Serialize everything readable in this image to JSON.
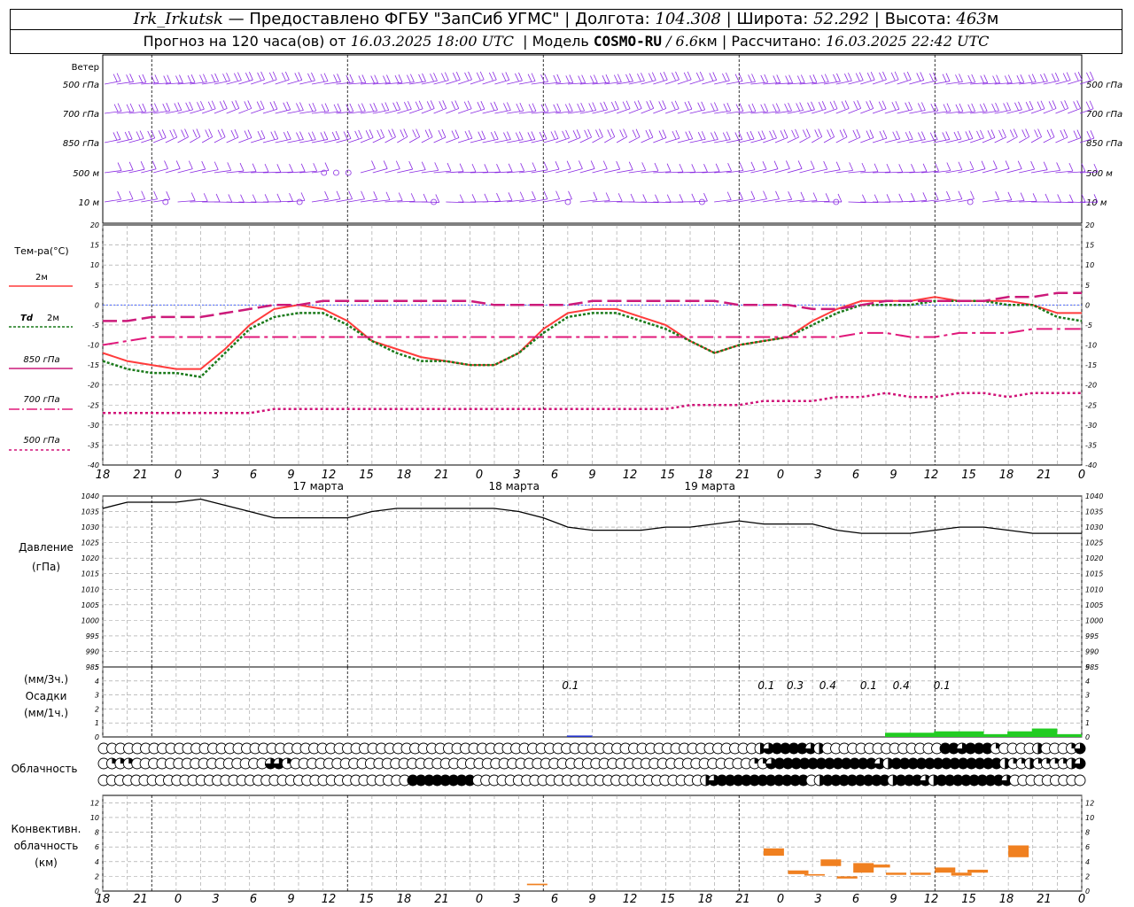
{
  "header": {
    "station": "Irk_Irkutsk",
    "dash": "—",
    "provider": "Предоставлено ФГБУ \"ЗапСиб УГМС\"",
    "lon_label": "Долгота:",
    "lon_value": "104.308",
    "lat_label": "Широта:",
    "lat_value": "52.292",
    "alt_label": "Высота:",
    "alt_value": "463",
    "alt_unit": "м",
    "forecast_label": "Прогноз на 120 часа(ов) от",
    "forecast_from": "16.03.2025 18:00 UTC",
    "model_label": "Модель",
    "model_name": "COSMO-RU",
    "model_res": "6.6",
    "model_res_unit": "км",
    "calc_label": "Рассчитано:",
    "calc_time": "16.03.2025 22:42 UTC"
  },
  "wind_panel": {
    "title": "Ветер",
    "levels": [
      "500 гПа",
      "700 гПа",
      "850 гПа",
      "500 м",
      "10 м"
    ],
    "color": "#8a2be2"
  },
  "time_axis": {
    "hour_ticks": [
      "18",
      "21",
      "0",
      "3",
      "6",
      "9",
      "12",
      "15",
      "18",
      "21",
      "0",
      "3",
      "6",
      "9",
      "12",
      "15",
      "18",
      "21",
      "0",
      "3",
      "6",
      "9",
      "12",
      "15",
      "18",
      "21",
      "0"
    ],
    "dates": [
      "17 марта",
      "18 марта",
      "19 марта"
    ]
  },
  "legend": {
    "temp_title": "Тем-ра(°С)",
    "t2m": "2м",
    "td_prefix": "Td",
    "td2m": "2м",
    "t850": "850 гПа",
    "t700": "700 гПа",
    "t500": "500 гПа"
  },
  "pressure_panel": {
    "title1": "Давление",
    "title2": "(гПа)"
  },
  "precip_panel": {
    "unit3": "(мм/3ч.)",
    "title": "Осадки",
    "unit1": "(мм/1ч.)",
    "labels": [
      "0.1",
      "0.1",
      "0.3",
      "0.4",
      "0.1",
      "0.4",
      "0.1"
    ]
  },
  "cloud_panel": {
    "title": "Облачность"
  },
  "conv_panel": {
    "title1": "Конвективн.",
    "title2": "облачность",
    "title3": "(км)"
  },
  "colors": {
    "t2m": "#ff3b3b",
    "td2m": "#1a7a1a",
    "t850": "#cc1a7a",
    "t700": "#e0187a",
    "t500": "#d01478",
    "pressure": "#000000",
    "precip_rain": "#22cc22",
    "precip_blue": "#2233cc",
    "conv": "#f08020",
    "wind": "#8a2be2",
    "zero_line": "#3050ff"
  },
  "chart_data": [
    {
      "type": "line",
      "name": "temperature",
      "x_hours": [
        0,
        3,
        6,
        9,
        12,
        15,
        18,
        21,
        24,
        27,
        30,
        33,
        36,
        39,
        42,
        45,
        48,
        51,
        54,
        57,
        60,
        63,
        66,
        69,
        72,
        75,
        78,
        81,
        84,
        87,
        90,
        93,
        96,
        99,
        102,
        105,
        108,
        111,
        114,
        117,
        120
      ],
      "ylim": [
        -40,
        20
      ],
      "series": [
        {
          "name": "2м",
          "values": [
            -12,
            -14,
            -15,
            -16,
            -16,
            -11,
            -5,
            -1,
            0,
            -1,
            -4,
            -9,
            -11,
            -13,
            -14,
            -15,
            -15,
            -12,
            -6,
            -2,
            -1,
            -1,
            -3,
            -5,
            -9,
            -12,
            -10,
            -9,
            -8,
            -4,
            -1,
            1,
            1,
            1,
            2,
            1,
            1,
            1,
            0,
            -2,
            -2
          ]
        },
        {
          "name": "Td 2м",
          "values": [
            -14,
            -16,
            -17,
            -17,
            -18,
            -12,
            -6,
            -3,
            -2,
            -2,
            -5,
            -9,
            -12,
            -14,
            -14,
            -15,
            -15,
            -12,
            -7,
            -3,
            -2,
            -2,
            -4,
            -6,
            -9,
            -12,
            -10,
            -9,
            -8,
            -5,
            -2,
            0,
            0,
            0,
            1,
            1,
            1,
            0,
            0,
            -3,
            -4
          ]
        },
        {
          "name": "850 гПа",
          "values": [
            -4,
            -4,
            -3,
            -3,
            -3,
            -2,
            -1,
            0,
            0,
            1,
            1,
            1,
            1,
            1,
            1,
            1,
            0,
            0,
            0,
            0,
            1,
            1,
            1,
            1,
            1,
            1,
            0,
            0,
            0,
            -1,
            -1,
            0,
            1,
            1,
            1,
            1,
            1,
            2,
            2,
            3,
            3
          ]
        },
        {
          "name": "700 гПа",
          "values": [
            -10,
            -9,
            -8,
            -8,
            -8,
            -8,
            -8,
            -8,
            -8,
            -8,
            -8,
            -8,
            -8,
            -8,
            -8,
            -8,
            -8,
            -8,
            -8,
            -8,
            -8,
            -8,
            -8,
            -8,
            -8,
            -8,
            -8,
            -8,
            -8,
            -8,
            -8,
            -7,
            -7,
            -8,
            -8,
            -7,
            -7,
            -7,
            -6,
            -6,
            -6
          ]
        },
        {
          "name": "500 гПа",
          "values": [
            -27,
            -27,
            -27,
            -27,
            -27,
            -27,
            -27,
            -26,
            -26,
            -26,
            -26,
            -26,
            -26,
            -26,
            -26,
            -26,
            -26,
            -26,
            -26,
            -26,
            -26,
            -26,
            -26,
            -26,
            -25,
            -25,
            -25,
            -24,
            -24,
            -24,
            -23,
            -23,
            -22,
            -23,
            -23,
            -22,
            -22,
            -23,
            -22,
            -22,
            -22
          ]
        }
      ]
    },
    {
      "type": "line",
      "name": "pressure",
      "x_hours": [
        0,
        3,
        6,
        9,
        12,
        15,
        18,
        21,
        24,
        27,
        30,
        33,
        36,
        39,
        42,
        45,
        48,
        51,
        54,
        57,
        60,
        63,
        66,
        69,
        72,
        75,
        78,
        81,
        84,
        87,
        90,
        93,
        96,
        99,
        102,
        105,
        108,
        111,
        114,
        117,
        120
      ],
      "ylim": [
        985,
        1040
      ],
      "values": [
        1036,
        1038,
        1038,
        1038,
        1039,
        1037,
        1035,
        1033,
        1033,
        1033,
        1033,
        1035,
        1036,
        1036,
        1036,
        1036,
        1036,
        1035,
        1033,
        1030,
        1029,
        1029,
        1029,
        1030,
        1030,
        1031,
        1032,
        1031,
        1031,
        1031,
        1029,
        1028,
        1028,
        1028,
        1029,
        1030,
        1030,
        1029,
        1028,
        1028,
        1028
      ]
    },
    {
      "type": "bar",
      "name": "precipitation",
      "x_hours": [
        57,
        96,
        99,
        102,
        105,
        108,
        111,
        114,
        117
      ],
      "values": [
        0.1,
        0.3,
        0.3,
        0.4,
        0.4,
        0.2,
        0.4,
        0.6,
        0.2
      ],
      "ylim": [
        0,
        5
      ]
    },
    {
      "type": "bar",
      "name": "convective_cloud",
      "ylim": [
        0,
        12
      ],
      "segments": [
        {
          "x_hours": 52,
          "base_km": 0.8,
          "top_km": 1.0
        },
        {
          "x_hours": 81,
          "base_km": 4.8,
          "top_km": 5.8
        },
        {
          "x_hours": 84,
          "base_km": 2.3,
          "top_km": 2.8
        },
        {
          "x_hours": 86,
          "base_km": 2.1,
          "top_km": 2.3
        },
        {
          "x_hours": 88,
          "base_km": 3.4,
          "top_km": 4.3
        },
        {
          "x_hours": 90,
          "base_km": 1.7,
          "top_km": 2.0
        },
        {
          "x_hours": 92,
          "base_km": 2.5,
          "top_km": 3.8
        },
        {
          "x_hours": 94,
          "base_km": 3.2,
          "top_km": 3.6
        },
        {
          "x_hours": 96,
          "base_km": 2.2,
          "top_km": 2.5
        },
        {
          "x_hours": 99,
          "base_km": 2.2,
          "top_km": 2.5
        },
        {
          "x_hours": 102,
          "base_km": 2.5,
          "top_km": 3.2
        },
        {
          "x_hours": 104,
          "base_km": 2.1,
          "top_km": 2.5
        },
        {
          "x_hours": 106,
          "base_km": 2.5,
          "top_km": 2.9
        },
        {
          "x_hours": 111,
          "base_km": 4.6,
          "top_km": 6.2
        }
      ]
    },
    {
      "type": "table",
      "name": "cloud_cover",
      "note_rows": [
        "upper",
        "middle",
        "lower"
      ],
      "x_hours_step": 1.5,
      "cover_fraction": {
        "upper": [
          0,
          0,
          0,
          0,
          0,
          0,
          0,
          0,
          0,
          0,
          0,
          0,
          0,
          0,
          0,
          0,
          0,
          0,
          0,
          0,
          0,
          0,
          0,
          0,
          0,
          0,
          0,
          0,
          0,
          0,
          0,
          0,
          0,
          0,
          0,
          0,
          0,
          0,
          0,
          0,
          0,
          0,
          0,
          0,
          0,
          0,
          0,
          0,
          0,
          0,
          0,
          0,
          0,
          0,
          0,
          0,
          0,
          0,
          0,
          0,
          0,
          0,
          0,
          0,
          0,
          0,
          0,
          0,
          0,
          0,
          0,
          0,
          0,
          0,
          0,
          0,
          0,
          0,
          0.5,
          0.75,
          1,
          1,
          1,
          1,
          0.75,
          0.5,
          0,
          0,
          0,
          0,
          0,
          0,
          0,
          0,
          0,
          0,
          0,
          0,
          0,
          0,
          1,
          1,
          0.75,
          1,
          1,
          1,
          0.25,
          0,
          0,
          0,
          0,
          0.5,
          0,
          0,
          0,
          0.25,
          0.75
        ],
        "middle": [
          0,
          0.25,
          0.25,
          0.25,
          0,
          0,
          0,
          0,
          0,
          0,
          0,
          0,
          0,
          0,
          0,
          0,
          0,
          0,
          0,
          0,
          0.75,
          0.75,
          0.25,
          0,
          0,
          0,
          0,
          0,
          0,
          0,
          0,
          0,
          0,
          0,
          0,
          0,
          0,
          0,
          0,
          0,
          0,
          0,
          0,
          0,
          0,
          0,
          0,
          0,
          0,
          0,
          0,
          0,
          0,
          0,
          0,
          0,
          0,
          0,
          0,
          0,
          0,
          0,
          0,
          0,
          0,
          0,
          0,
          0,
          0,
          0,
          0,
          0,
          0,
          0,
          0,
          0,
          0,
          0,
          0.25,
          0.25,
          0.75,
          1,
          1,
          1,
          1,
          1,
          1,
          1,
          1,
          1,
          1,
          1,
          1,
          0.75,
          0.5,
          1,
          1,
          1,
          1,
          1,
          1,
          1,
          1,
          1,
          1,
          1,
          1,
          1,
          0.5,
          0.25,
          0.25,
          0.5,
          0.25,
          0.25,
          0.25,
          0.25,
          0.5,
          0.75
        ],
        "lower": [
          0,
          0,
          0,
          0,
          0,
          0,
          0,
          0,
          0,
          0,
          0,
          0,
          0,
          0,
          0,
          0,
          0,
          0,
          0,
          0,
          0,
          0,
          0,
          0,
          0,
          0,
          0,
          0,
          0,
          0,
          0,
          0,
          0,
          0,
          0,
          0,
          0,
          0,
          1,
          1,
          1,
          1,
          1,
          1,
          1,
          1,
          0,
          0,
          0,
          0,
          0,
          0,
          0,
          0,
          0,
          0,
          0,
          0,
          0,
          0,
          0,
          0,
          0,
          0,
          0,
          0,
          0,
          0,
          0,
          0,
          0,
          0,
          0,
          0,
          0.5,
          0.75,
          1,
          1,
          1,
          1,
          1,
          1,
          1,
          1,
          1,
          1,
          1,
          0,
          0.5,
          1,
          1,
          1,
          1,
          1,
          1,
          1,
          1,
          0.5,
          1,
          1,
          1,
          0.75,
          0.5,
          1,
          1,
          1,
          1,
          1,
          1,
          1,
          1,
          0.75,
          0,
          0,
          0,
          0,
          0,
          0,
          0,
          0,
          0
        ]
      }
    }
  ]
}
